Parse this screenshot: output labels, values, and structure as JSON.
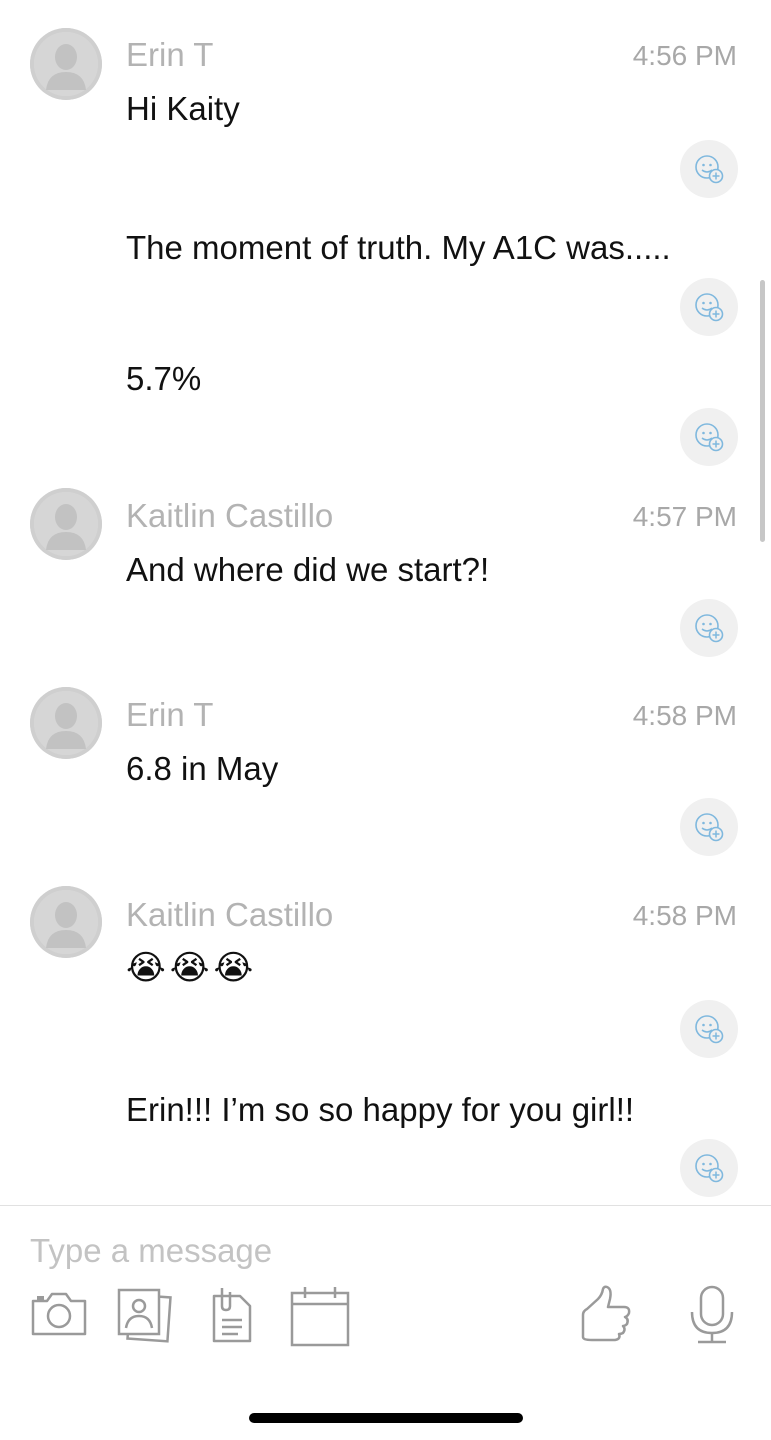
{
  "messages": [
    {
      "sender": "Erin T",
      "time": "4:56 PM",
      "lines": [
        "Hi Kaity",
        "The moment of truth.  My A1C was.....",
        "5.7%"
      ]
    },
    {
      "sender": "Kaitlin Castillo",
      "time": "4:57 PM",
      "lines": [
        "And where did we start?!"
      ]
    },
    {
      "sender": "Erin T",
      "time": "4:58 PM",
      "lines": [
        "6.8 in May"
      ]
    },
    {
      "sender": "Kaitlin Castillo",
      "time": "4:58 PM",
      "lines": [
        "😭😭😭",
        "Erin!!! I’m so so happy for you girl!!"
      ]
    }
  ],
  "composer": {
    "placeholder": "Type a message"
  },
  "icons": {
    "avatar": "person-silhouette-icon",
    "reaction": "add-reaction-icon",
    "toolbar": [
      "camera-icon",
      "photo-icon",
      "document-icon",
      "calendar-icon",
      "thumbs-up-icon",
      "microphone-icon"
    ]
  },
  "colors": {
    "accent": "#4a9fd8",
    "muted_text": "#b3b3b3",
    "text": "#111111"
  }
}
